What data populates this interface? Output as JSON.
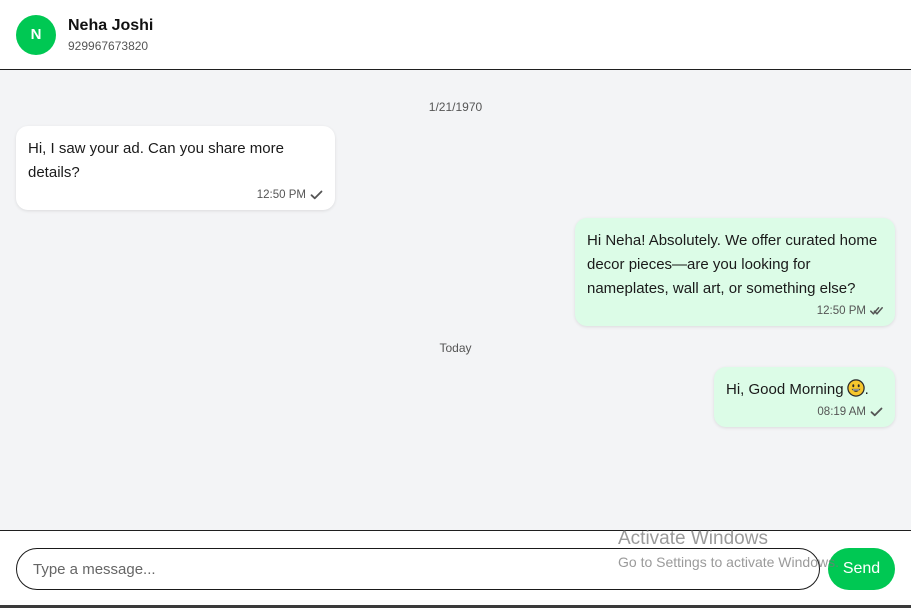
{
  "header": {
    "avatar_letter": "N",
    "avatar_color": "#00c853",
    "contact_name": "Neha Joshi",
    "contact_phone": "929967673820"
  },
  "conversation": {
    "date_separator_1": "1/21/1970",
    "date_separator_2": "Today",
    "messages": [
      {
        "direction": "incoming",
        "text": "Hi, I saw your ad. Can you share more details?",
        "time": "12:50 PM",
        "status_icon": "check-icon"
      },
      {
        "direction": "outgoing",
        "text": "Hi Neha! Absolutely. We offer curated home decor pieces—are you looking for nameplates, wall art, or something else?",
        "time": "12:50 PM",
        "status_icon": "double-check-icon"
      },
      {
        "direction": "outgoing",
        "text_before_emoji": "Hi, Good Morning",
        "emoji": "grinning-face-emoji",
        "text_after_emoji": ".",
        "time": "08:19 AM",
        "status_icon": "check-icon"
      }
    ]
  },
  "composer": {
    "placeholder": "Type a message...",
    "send_label": "Send",
    "send_color": "#00c853"
  },
  "watermark": {
    "title": "Activate Windows",
    "subtitle": "Go to Settings to activate Windows."
  },
  "colors": {
    "incoming_bubble": "#ffffff",
    "outgoing_bubble": "#dcfce7",
    "chat_background": "#f3f4f6"
  }
}
